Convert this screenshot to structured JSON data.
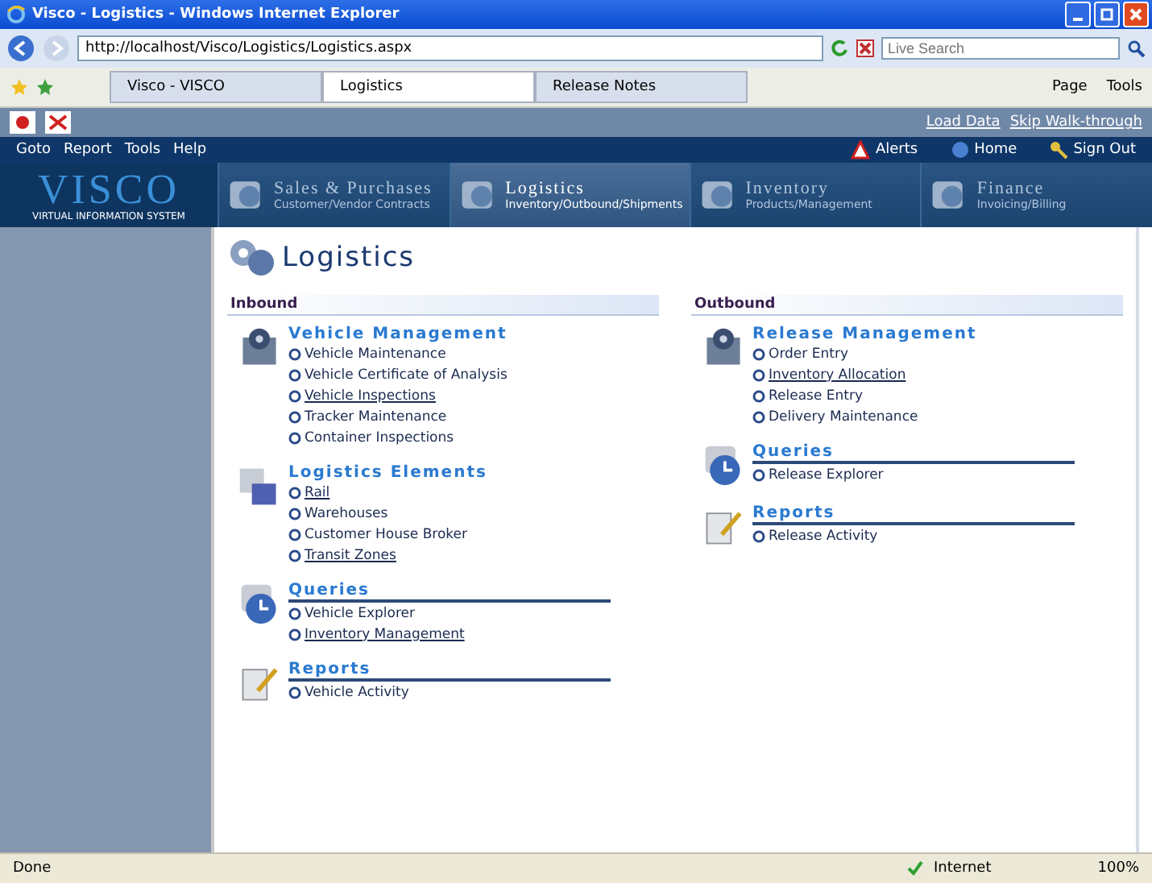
{
  "window": {
    "title": "Visco - Logistics - Windows Internet Explorer"
  },
  "address_bar": {
    "url": "http://localhost/Visco/Logistics/Logistics.aspx",
    "search_placeholder": "Live Search"
  },
  "browser_tabs": [
    {
      "label": "Visco - VISCO",
      "selected": false
    },
    {
      "label": "Logistics",
      "selected": true
    },
    {
      "label": "Release Notes",
      "selected": false
    }
  ],
  "toolbar_buttons": [
    "Page",
    "Tools"
  ],
  "app_links": [
    "Load Data",
    "Skip Walk-through"
  ],
  "menu": [
    "Goto",
    "Report",
    "Tools",
    "Help"
  ],
  "menu_right": [
    {
      "kind": "alert",
      "label": "Alerts"
    },
    {
      "kind": "home",
      "label": "Home"
    },
    {
      "kind": "signout",
      "label": "Sign Out"
    }
  ],
  "logo": {
    "name": "VISCO",
    "tagline": "VIRTUAL INFORMATION SYSTEM"
  },
  "modules": [
    {
      "title": "Sales & Purchases",
      "subtitle": "Customer/Vendor Contracts",
      "selected": false
    },
    {
      "title": "Logistics",
      "subtitle": "Inventory/Outbound/Shipments",
      "selected": true
    },
    {
      "title": "Inventory",
      "subtitle": "Products/Management",
      "selected": false
    },
    {
      "title": "Finance",
      "subtitle": "Invoicing/Billing",
      "selected": false
    }
  ],
  "page_title": "Logistics",
  "columns": [
    {
      "heading": "Inbound",
      "groups": [
        {
          "kind": "management",
          "title": "Vehicle Management",
          "items": [
            {
              "label": "Vehicle Maintenance",
              "visited": false
            },
            {
              "label": "Vehicle Certificate of Analysis",
              "visited": false
            },
            {
              "label": "Vehicle Inspections",
              "visited": true
            },
            {
              "label": "Tracker Maintenance",
              "visited": false
            },
            {
              "label": "Container Inspections",
              "visited": false
            }
          ]
        },
        {
          "kind": "elements",
          "title": "Logistics Elements",
          "items": [
            {
              "label": "Rail",
              "visited": true
            },
            {
              "label": "Warehouses",
              "visited": false
            },
            {
              "label": "Customer House Broker",
              "visited": false
            },
            {
              "label": "Transit Zones",
              "visited": true
            }
          ]
        },
        {
          "kind": "queries",
          "title": "Queries",
          "items": [
            {
              "label": "Vehicle Explorer",
              "visited": false
            },
            {
              "label": "Inventory Management",
              "visited": true
            }
          ]
        },
        {
          "kind": "reports",
          "title": "Reports",
          "items": [
            {
              "label": "Vehicle Activity",
              "visited": false
            }
          ]
        }
      ]
    },
    {
      "heading": "Outbound",
      "groups": [
        {
          "kind": "management",
          "title": "Release Management",
          "items": [
            {
              "label": "Order Entry",
              "visited": false
            },
            {
              "label": "Inventory Allocation",
              "visited": true
            },
            {
              "label": "Release Entry",
              "visited": false
            },
            {
              "label": "Delivery Maintenance",
              "visited": false
            }
          ]
        },
        {
          "kind": "queries",
          "title": "Queries",
          "items": [
            {
              "label": "Release Explorer",
              "visited": false
            }
          ]
        },
        {
          "kind": "reports",
          "title": "Reports",
          "items": [
            {
              "label": "Release Activity",
              "visited": false
            }
          ]
        }
      ]
    }
  ],
  "status_bar": {
    "text": "Done",
    "zone": "Internet",
    "zoom": "100%"
  }
}
